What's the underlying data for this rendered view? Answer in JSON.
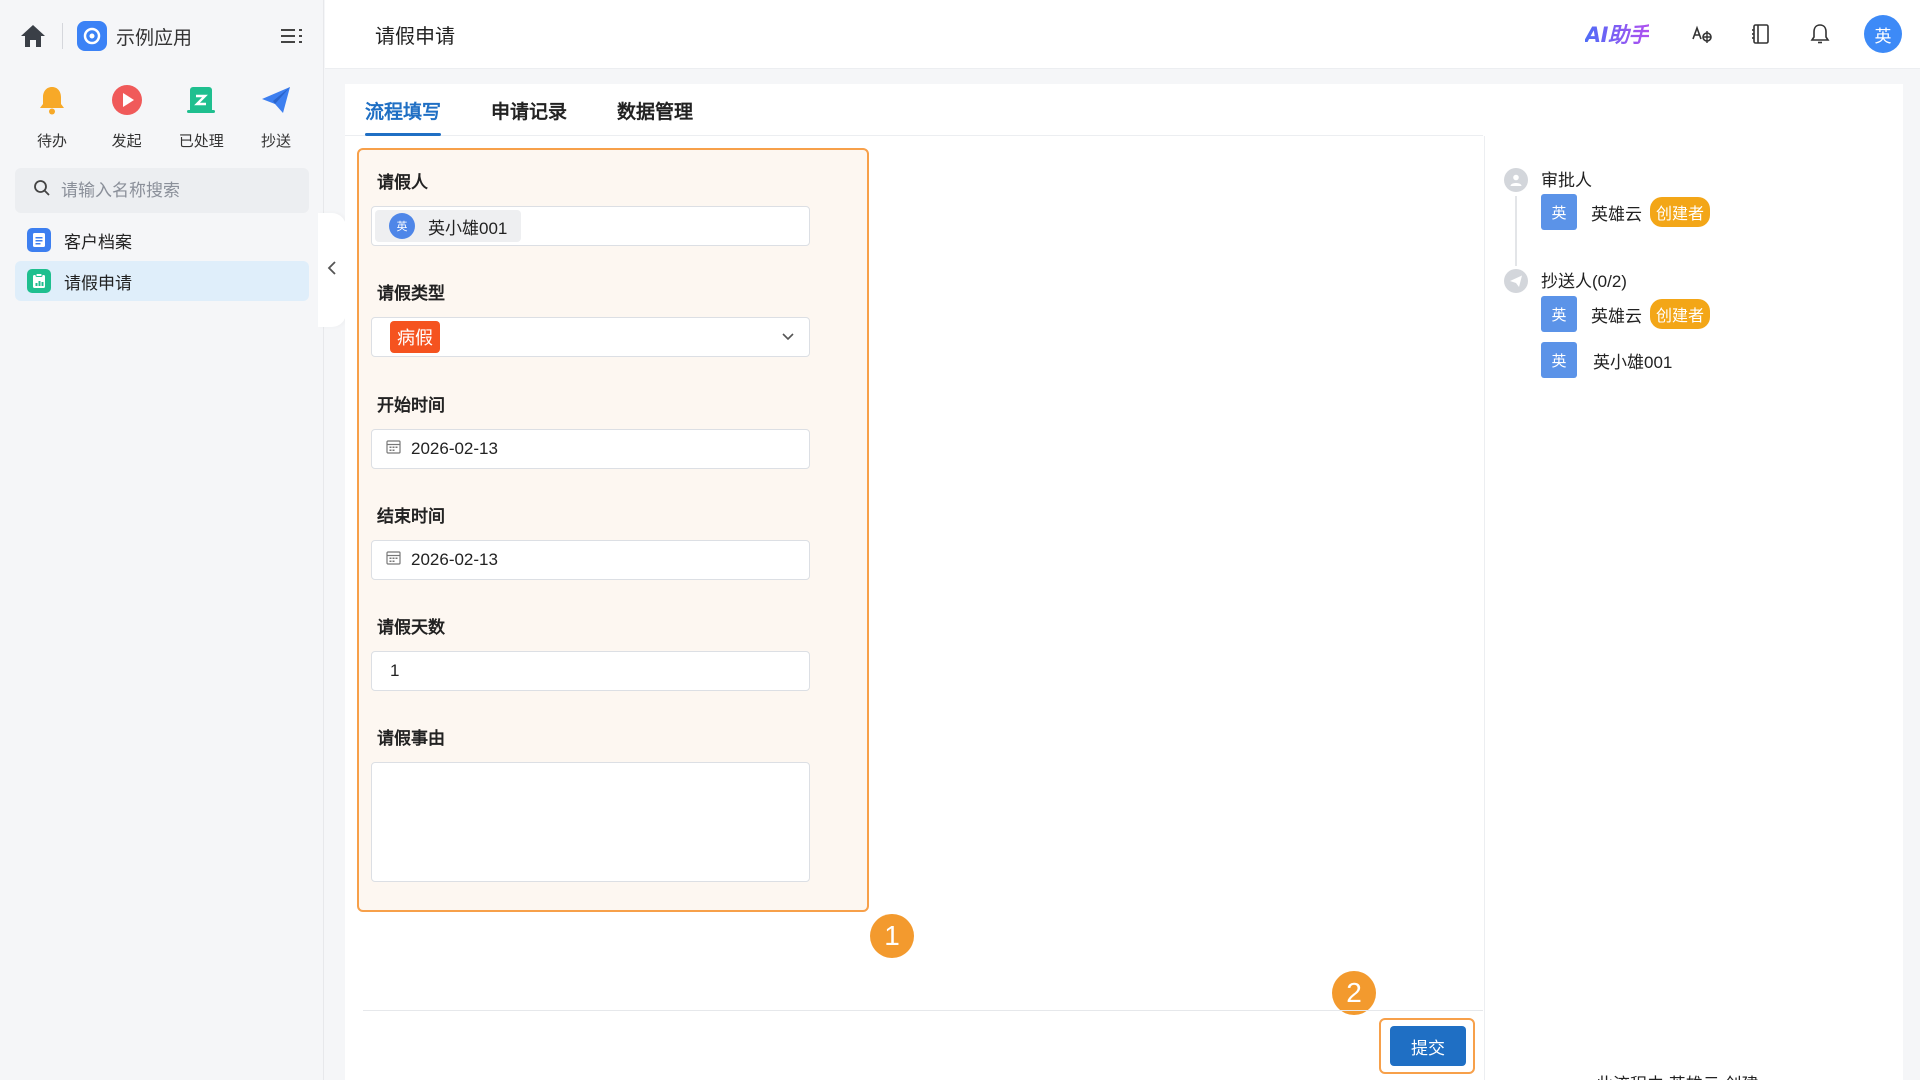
{
  "app": {
    "name": "示例应用"
  },
  "quick_actions": [
    {
      "label": "待办",
      "icon": "bell-icon"
    },
    {
      "label": "发起",
      "icon": "play-icon"
    },
    {
      "label": "已处理",
      "icon": "processed-icon"
    },
    {
      "label": "抄送",
      "icon": "send-icon"
    }
  ],
  "search": {
    "placeholder": "请输入名称搜索"
  },
  "nav": {
    "items": [
      {
        "label": "客户档案",
        "icon": "document-icon",
        "active": false
      },
      {
        "label": "请假申请",
        "icon": "form-icon",
        "active": true
      }
    ]
  },
  "header": {
    "title": "请假申请",
    "ai_label": "AI助手",
    "avatar": "英"
  },
  "tabs": [
    {
      "label": "流程填写",
      "active": true
    },
    {
      "label": "申请记录",
      "active": false
    },
    {
      "label": "数据管理",
      "active": false
    }
  ],
  "form": {
    "applicant": {
      "label": "请假人",
      "avatar": "英",
      "value": "英小雄001"
    },
    "leave_type": {
      "label": "请假类型",
      "value": "病假"
    },
    "start_time": {
      "label": "开始时间",
      "value": "2026-02-13"
    },
    "end_time": {
      "label": "结束时间",
      "value": "2026-02-13"
    },
    "days": {
      "label": "请假天数",
      "value": "1"
    },
    "reason": {
      "label": "请假事由",
      "value": ""
    }
  },
  "step_badges": [
    "1",
    "2"
  ],
  "actions": {
    "submit_label": "提交"
  },
  "flow": {
    "approver": {
      "title": "审批人",
      "people": [
        {
          "avatar": "英",
          "name": "英雄云",
          "tag": "创建者"
        }
      ]
    },
    "cc": {
      "title": "抄送人(0/2)",
      "people": [
        {
          "avatar": "英",
          "name": "英雄云",
          "tag": "创建者"
        },
        {
          "avatar": "英",
          "name": "英小雄001",
          "tag": ""
        }
      ]
    },
    "footer": "此流程由 英雄云 创建"
  },
  "colors": {
    "accent": "#1f6fc4",
    "highlight_border": "#f7a04a",
    "badge": "#f39a2e",
    "leave_tag": "#f5531f",
    "creator_tag": "#f3a617"
  }
}
